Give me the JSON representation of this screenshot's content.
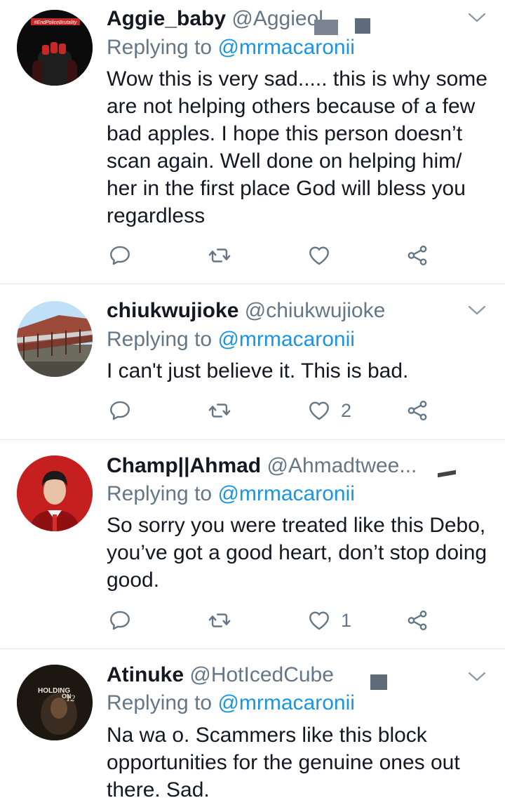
{
  "tweets": [
    {
      "name": "Aggie_baby",
      "handle": "@Aggieol",
      "replying_prefix": "Replying to",
      "replying_to": "@mrmacaronii",
      "text": "Wow this is very sad..... this is why some are not helping others because of a few bad apples. I hope this person doesn’t scan again. Well done on helping him/ her in the first place God will bless you regardless",
      "avatar_label": "#EndPoliceBrutality",
      "replies": "",
      "retweets": "",
      "likes": ""
    },
    {
      "name": "chiukwujioke",
      "handle": "@chiukwujioke",
      "replying_prefix": "Replying to",
      "replying_to": "@mrmacaronii",
      "text": "I can't just believe it. This is bad.",
      "replies": "",
      "retweets": "",
      "likes": "2"
    },
    {
      "name": "Champ||Ahmad",
      "handle": "@Ahmadtwee...",
      "replying_prefix": "Replying to",
      "replying_to": "@mrmacaronii",
      "text": "So sorry you were treated like this Debo, you’ve got a good heart, don’t stop doing good.",
      "replies": "",
      "retweets": "",
      "likes": "1"
    },
    {
      "name": "Atinuke",
      "handle": "@HotIcedCube",
      "replying_prefix": "Replying to",
      "replying_to": "@mrmacaronii",
      "text": "Na wa o. Scammers like this block opportunities for the genuine ones out there. Sad.",
      "avatar_label": "HOLDING",
      "avatar_label2": "ON",
      "avatar_mark": "12"
    }
  ],
  "icons": {
    "reply": "reply-icon",
    "retweet": "retweet-icon",
    "like": "heart-icon",
    "share": "share-icon",
    "menu": "chevron-down-icon"
  },
  "colors": {
    "text": "#141823",
    "secondary": "#657786",
    "link": "#1b95e0",
    "divider": "#e1e8ed"
  }
}
